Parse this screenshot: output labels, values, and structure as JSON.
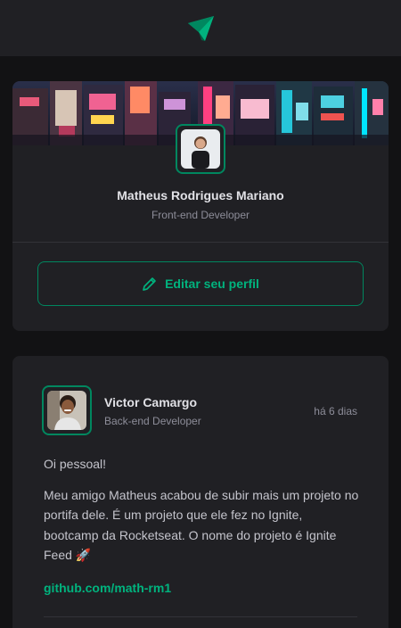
{
  "header": {
    "logo_icon": "ignite-feed-logo-icon"
  },
  "profile": {
    "name": "Matheus Rodrigues Mariano",
    "role": "Front-end Developer",
    "edit_label": "Editar seu perfil",
    "edit_icon": "pencil-icon"
  },
  "post": {
    "author": {
      "name": "Victor Camargo",
      "role": "Back-end Developer"
    },
    "time": "há 6 dias",
    "paragraphs": [
      "Oi pessoal!",
      "Meu amigo Matheus acabou de subir mais um projeto no portifa dele. É um projeto que ele fez no Ignite, bootcamp da Rocketseat. O nome do projeto é Ignite Feed 🚀"
    ],
    "link": "github.com/math-rm1"
  },
  "colors": {
    "background": "#121214",
    "card": "#202024",
    "accent": "#00b37e",
    "accent_dark": "#00875f",
    "text_muted": "#8d8d99"
  }
}
